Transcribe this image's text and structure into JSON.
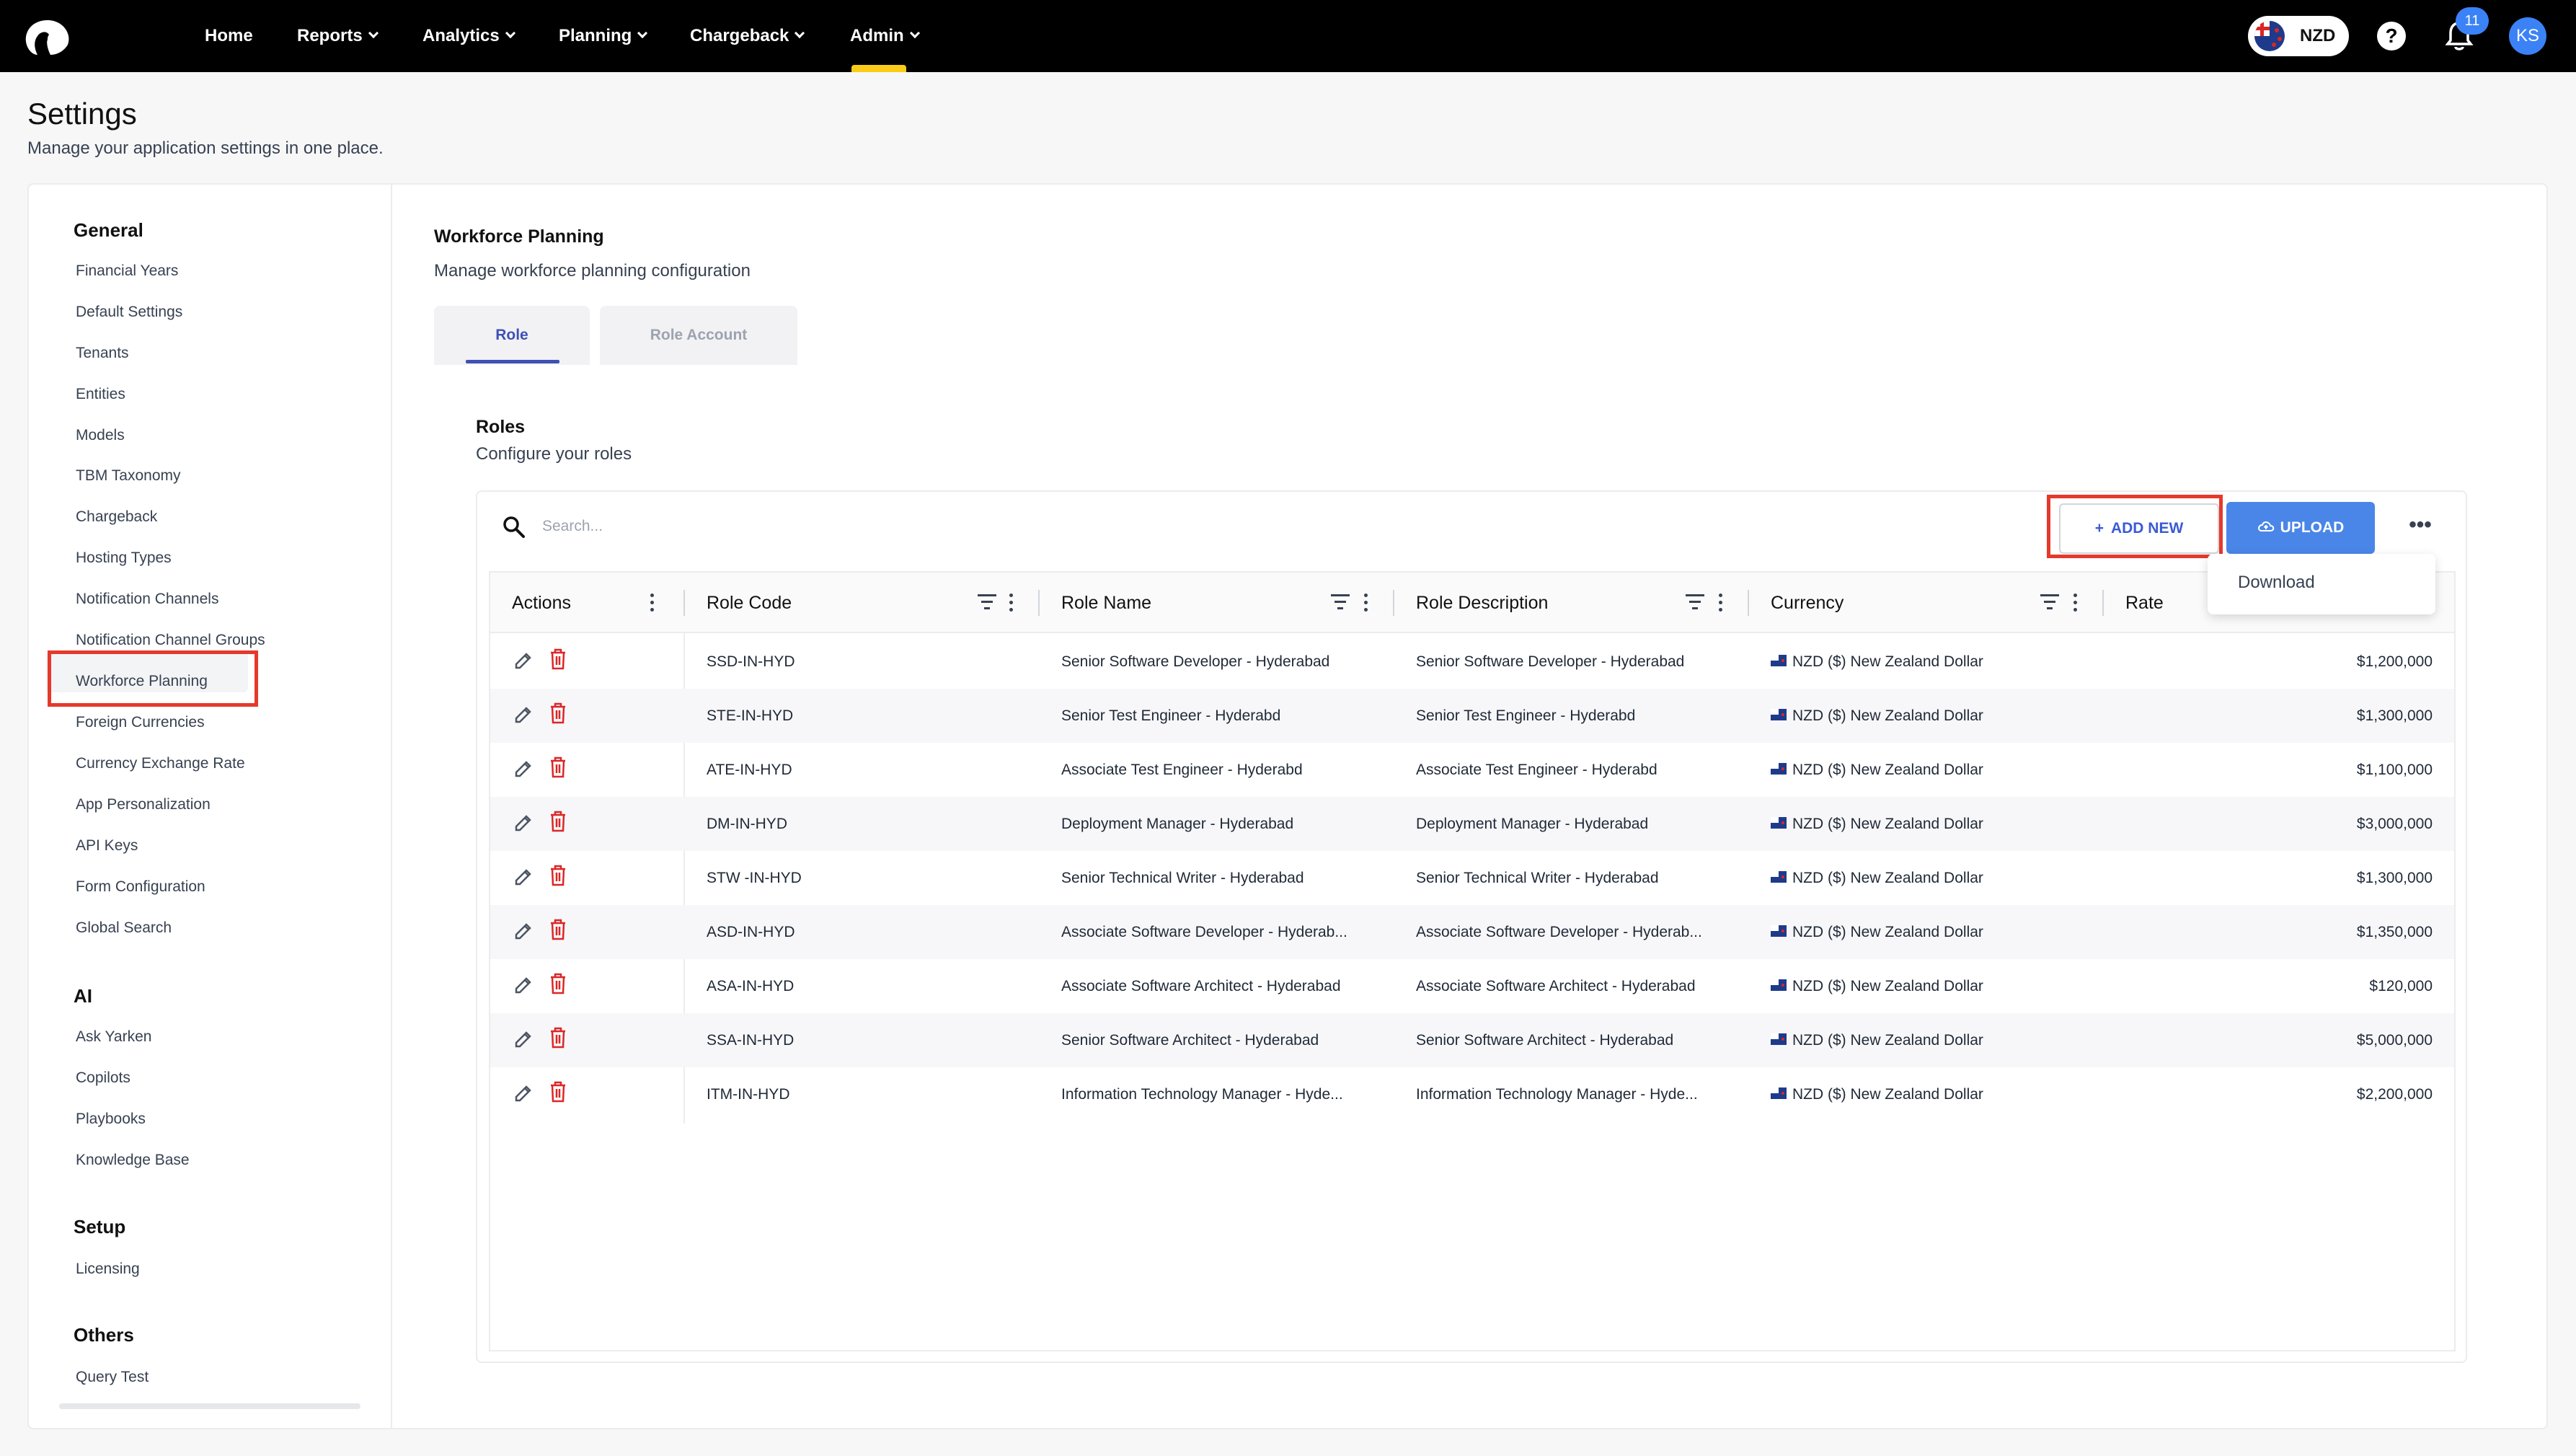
{
  "nav": {
    "items": [
      {
        "label": "Home",
        "has_dropdown": false
      },
      {
        "label": "Reports",
        "has_dropdown": true
      },
      {
        "label": "Analytics",
        "has_dropdown": true
      },
      {
        "label": "Planning",
        "has_dropdown": true
      },
      {
        "label": "Chargeback",
        "has_dropdown": true
      },
      {
        "label": "Admin",
        "has_dropdown": true,
        "active": true
      }
    ],
    "currency": "NZD",
    "notifications_count": "11",
    "avatar_initials": "KS",
    "accent_color": "#facc15"
  },
  "page": {
    "title": "Settings",
    "subtitle": "Manage your application settings in one place."
  },
  "sidebar": {
    "sections": [
      {
        "title": "General",
        "items": [
          "Financial Years",
          "Default Settings",
          "Tenants",
          "Entities",
          "Models",
          "TBM Taxonomy",
          "Chargeback",
          "Hosting Types",
          "Notification Channels",
          "Notification Channel Groups",
          "Workforce Planning",
          "Foreign Currencies",
          "Currency Exchange Rate",
          "App Personalization",
          "API Keys",
          "Form Configuration",
          "Global Search"
        ]
      },
      {
        "title": "AI",
        "items": [
          "Ask Yarken",
          "Copilots",
          "Playbooks",
          "Knowledge Base"
        ]
      },
      {
        "title": "Setup",
        "items": [
          "Licensing"
        ]
      },
      {
        "title": "Others",
        "items": [
          "Query Test"
        ]
      }
    ],
    "selected": "Workforce Planning"
  },
  "content": {
    "title": "Workforce Planning",
    "subtitle": "Manage workforce planning configuration",
    "tabs": [
      {
        "label": "Role",
        "active": true
      },
      {
        "label": "Role Account",
        "active": false
      }
    ],
    "roles_title": "Roles",
    "roles_subtitle": "Configure your roles",
    "search_placeholder": "Search...",
    "add_new_label": "ADD NEW",
    "upload_label": "UPLOAD",
    "dropdown_items": [
      "Download"
    ]
  },
  "table": {
    "columns": [
      "Actions",
      "Role Code",
      "Role Name",
      "Role Description",
      "Currency",
      "Rate"
    ],
    "rows": [
      {
        "code": "SSD-IN-HYD",
        "name": "Senior Software Developer - Hyderabad",
        "description": "Senior Software Developer - Hyderabad",
        "currency": "NZD ($) New Zealand Dollar",
        "rate": "$1,200,000"
      },
      {
        "code": "STE-IN-HYD",
        "name": "Senior Test Engineer - Hyderabd",
        "description": "Senior Test Engineer - Hyderabd",
        "currency": "NZD ($) New Zealand Dollar",
        "rate": "$1,300,000"
      },
      {
        "code": "ATE-IN-HYD",
        "name": "Associate Test Engineer - Hyderabd",
        "description": "Associate Test Engineer - Hyderabd",
        "currency": "NZD ($) New Zealand Dollar",
        "rate": "$1,100,000"
      },
      {
        "code": "DM-IN-HYD",
        "name": "Deployment Manager - Hyderabad",
        "description": "Deployment Manager - Hyderabad",
        "currency": "NZD ($) New Zealand Dollar",
        "rate": "$3,000,000"
      },
      {
        "code": "STW -IN-HYD",
        "name": "Senior Technical Writer - Hyderabad",
        "description": "Senior Technical Writer - Hyderabad",
        "currency": "NZD ($) New Zealand Dollar",
        "rate": "$1,300,000"
      },
      {
        "code": "ASD-IN-HYD",
        "name": "Associate Software Developer - Hyderab...",
        "description": "Associate Software Developer - Hyderab...",
        "currency": "NZD ($) New Zealand Dollar",
        "rate": "$1,350,000"
      },
      {
        "code": "ASA-IN-HYD",
        "name": "Associate Software Architect - Hyderabad",
        "description": "Associate Software Architect - Hyderabad",
        "currency": "NZD ($) New Zealand Dollar",
        "rate": "$120,000"
      },
      {
        "code": "SSA-IN-HYD",
        "name": "Senior Software Architect - Hyderabad",
        "description": "Senior Software Architect - Hyderabad",
        "currency": "NZD ($) New Zealand Dollar",
        "rate": "$5,000,000"
      },
      {
        "code": "ITM-IN-HYD",
        "name": "Information Technology Manager - Hyde...",
        "description": "Information Technology Manager - Hyde...",
        "currency": "NZD ($) New Zealand Dollar",
        "rate": "$2,200,000"
      }
    ]
  },
  "colors": {
    "highlight": "#e5392b",
    "primary": "#4a86e8",
    "tab_active": "#3f51b5",
    "delete": "#dc2626"
  }
}
